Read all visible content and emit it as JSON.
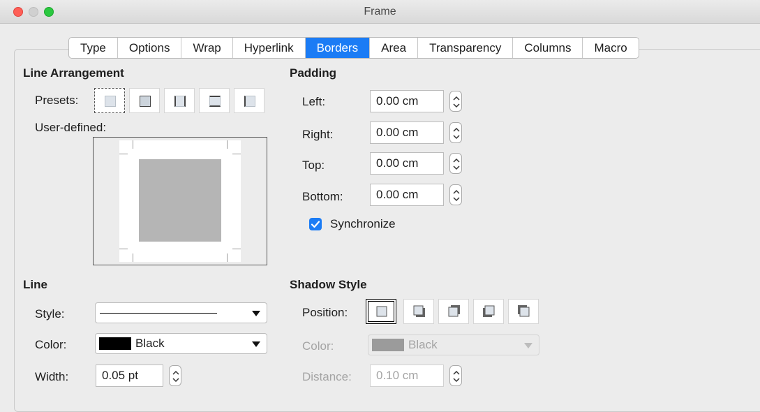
{
  "window": {
    "title": "Frame"
  },
  "tabs": [
    {
      "label": "Type"
    },
    {
      "label": "Options"
    },
    {
      "label": "Wrap"
    },
    {
      "label": "Hyperlink"
    },
    {
      "label": "Borders",
      "active": true
    },
    {
      "label": "Area"
    },
    {
      "label": "Transparency"
    },
    {
      "label": "Columns"
    },
    {
      "label": "Macro"
    }
  ],
  "line_arrangement": {
    "title": "Line Arrangement",
    "presets_label": "Presets:",
    "user_defined_label": "User-defined:",
    "presets_count": 5,
    "selected_preset": 0
  },
  "padding": {
    "title": "Padding",
    "left": {
      "label": "Left:",
      "value": "0.00 cm"
    },
    "right": {
      "label": "Right:",
      "value": "0.00 cm"
    },
    "top": {
      "label": "Top:",
      "value": "0.00 cm"
    },
    "bottom": {
      "label": "Bottom:",
      "value": "0.00 cm"
    },
    "synchronize": {
      "label": "Synchronize",
      "checked": true
    }
  },
  "line": {
    "title": "Line",
    "style_label": "Style:",
    "color_label": "Color:",
    "color_value": "Black",
    "width_label": "Width:",
    "width_value": "0.05 pt"
  },
  "shadow": {
    "title": "Shadow Style",
    "position_label": "Position:",
    "color_label": "Color:",
    "color_value": "Black",
    "distance_label": "Distance:",
    "distance_value": "0.10 cm",
    "selected_position": 0
  },
  "colors": {
    "accent": "#1b7cf5",
    "close": "#fe5f57",
    "maximize": "#2bc840"
  }
}
